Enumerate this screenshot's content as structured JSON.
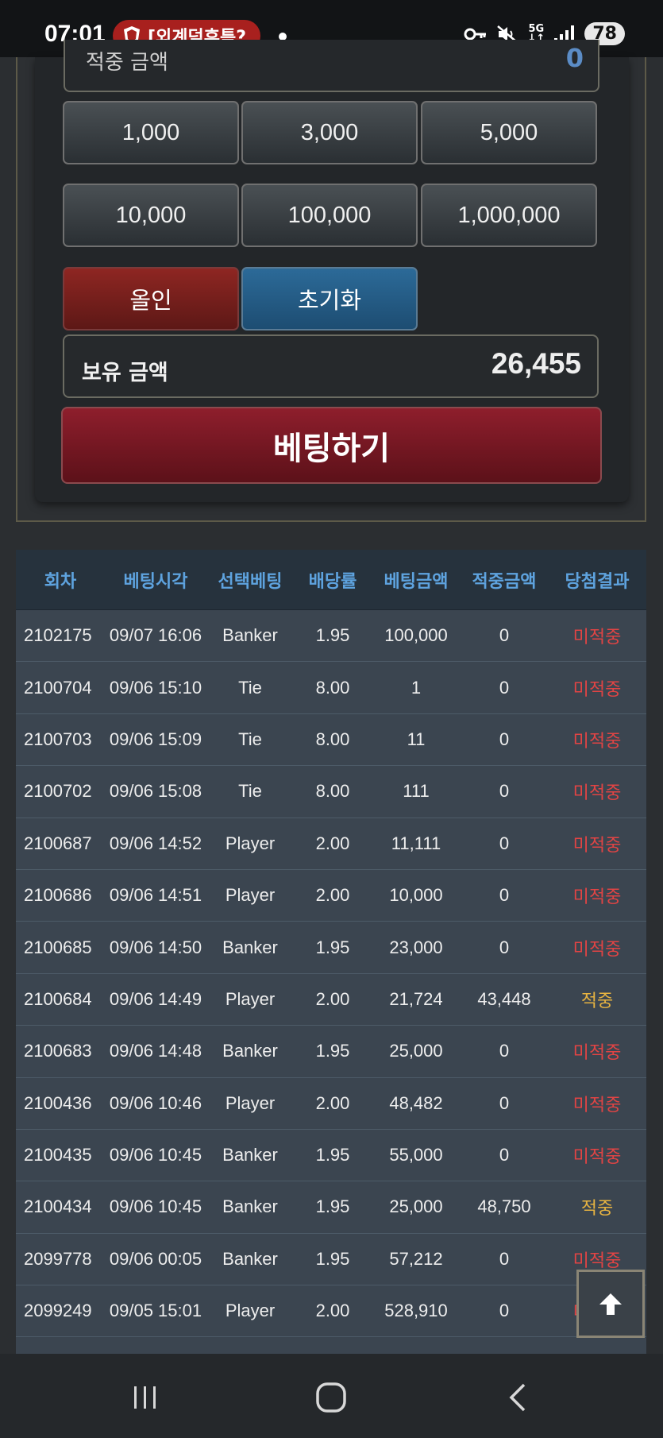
{
  "status_bar": {
    "time": "07:01",
    "notification_text": "[외계덕후특?",
    "battery": "78",
    "network": "5G"
  },
  "bet_panel": {
    "win_amount_label": "적중 금액",
    "win_amount_value": "0",
    "amount_buttons": [
      "1,000",
      "3,000",
      "5,000",
      "10,000",
      "100,000",
      "1,000,000"
    ],
    "allin_label": "올인",
    "reset_label": "초기화",
    "balance_label": "보유 금액",
    "balance_value": "26,455",
    "bet_button_label": "베팅하기"
  },
  "history": {
    "headers": [
      "회차",
      "베팅시각",
      "선택베팅",
      "배당률",
      "베팅금액",
      "적중금액",
      "당첨결과"
    ],
    "rows": [
      [
        "2102175",
        "09/07 16:06",
        "Banker",
        "1.95",
        "100,000",
        "0",
        "미적중"
      ],
      [
        "2100704",
        "09/06 15:10",
        "Tie",
        "8.00",
        "1",
        "0",
        "미적중"
      ],
      [
        "2100703",
        "09/06 15:09",
        "Tie",
        "8.00",
        "11",
        "0",
        "미적중"
      ],
      [
        "2100702",
        "09/06 15:08",
        "Tie",
        "8.00",
        "111",
        "0",
        "미적중"
      ],
      [
        "2100687",
        "09/06 14:52",
        "Player",
        "2.00",
        "11,111",
        "0",
        "미적중"
      ],
      [
        "2100686",
        "09/06 14:51",
        "Player",
        "2.00",
        "10,000",
        "0",
        "미적중"
      ],
      [
        "2100685",
        "09/06 14:50",
        "Banker",
        "1.95",
        "23,000",
        "0",
        "미적중"
      ],
      [
        "2100684",
        "09/06 14:49",
        "Player",
        "2.00",
        "21,724",
        "43,448",
        "적중"
      ],
      [
        "2100683",
        "09/06 14:48",
        "Banker",
        "1.95",
        "25,000",
        "0",
        "미적중"
      ],
      [
        "2100436",
        "09/06 10:46",
        "Player",
        "2.00",
        "48,482",
        "0",
        "미적중"
      ],
      [
        "2100435",
        "09/06 10:45",
        "Banker",
        "1.95",
        "55,000",
        "0",
        "미적중"
      ],
      [
        "2100434",
        "09/06 10:45",
        "Banker",
        "1.95",
        "25,000",
        "48,750",
        "적중"
      ],
      [
        "2099778",
        "09/06 00:05",
        "Banker",
        "1.95",
        "57,212",
        "0",
        "미적중"
      ],
      [
        "2099249",
        "09/05 15:01",
        "Player",
        "2.00",
        "528,910",
        "0",
        "미적중"
      ]
    ]
  },
  "colors": {
    "miss": "#e14444",
    "hit": "#e7b341",
    "header_text": "#5ea3df"
  }
}
